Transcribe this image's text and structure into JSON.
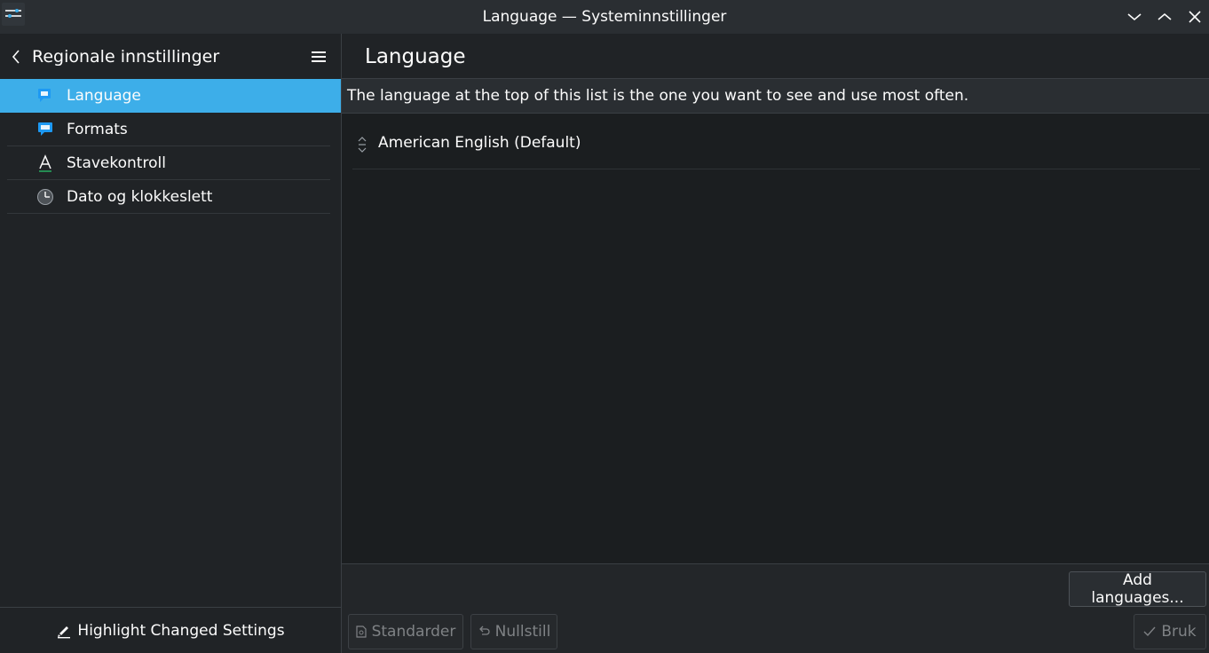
{
  "window": {
    "title": "Language — Systeminnstillinger"
  },
  "sidebar": {
    "title": "Regionale innstillinger",
    "items": [
      {
        "label": "Language",
        "icon": "language-flag-icon",
        "active": true
      },
      {
        "label": "Formats",
        "icon": "formats-flag-icon",
        "active": false
      },
      {
        "label": "Stavekontroll",
        "icon": "spellcheck-icon",
        "active": false
      },
      {
        "label": "Dato og klokkeslett",
        "icon": "clock-icon",
        "active": false
      }
    ],
    "footer_button": "Highlight Changed Settings"
  },
  "main": {
    "page_title": "Language",
    "info_text": "The language at the top of this list is the one you want to see and use most often.",
    "languages": [
      {
        "label": "American English (Default)"
      }
    ],
    "add_button": "Add languages...",
    "defaults_button": "Standarder",
    "reset_button": "Nullstill",
    "apply_button": "Bruk"
  },
  "colors": {
    "accent": "#3daee9",
    "window_bg": "#1b1e20",
    "sidebar_bg": "#202326",
    "titlebar_bg": "#2a2e32",
    "text": "#fcfcfc",
    "disabled_text": "#7f8285"
  }
}
